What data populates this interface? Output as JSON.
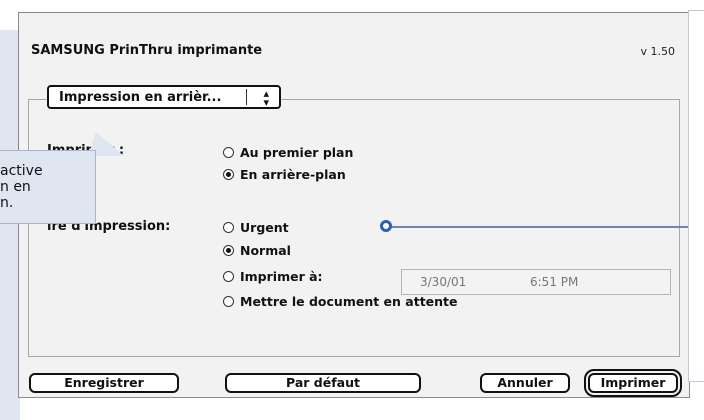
{
  "dialog": {
    "title": "SAMSUNG PrinThru imprimante",
    "version": "v 1.50"
  },
  "popup": {
    "label": "Impression en arrièr...",
    "arrows_icon": "up-down-arrows"
  },
  "imprimer": {
    "label": "Imprimer :",
    "options": [
      {
        "label": "Au premier plan",
        "selected": false
      },
      {
        "label": "En arrière-plan",
        "selected": true
      }
    ]
  },
  "priority": {
    "label": "ire d'impression:",
    "options": [
      {
        "label": "Urgent",
        "selected": false
      },
      {
        "label": "Normal",
        "selected": true
      },
      {
        "label": "Imprimer à:",
        "selected": false
      },
      {
        "label": "Mettre le document en attente",
        "selected": false
      }
    ],
    "date": "3/30/01",
    "time": "6:51 PM"
  },
  "buttons": {
    "save": "Enregistrer",
    "default": "Par défaut",
    "cancel": "Annuler",
    "print": "Imprimer"
  },
  "callout": {
    "line1": "active",
    "line2": "n en",
    "line3": "n."
  },
  "colors": {
    "accent": "#2f5fb1",
    "callout_bg": "#dfe6f1"
  }
}
